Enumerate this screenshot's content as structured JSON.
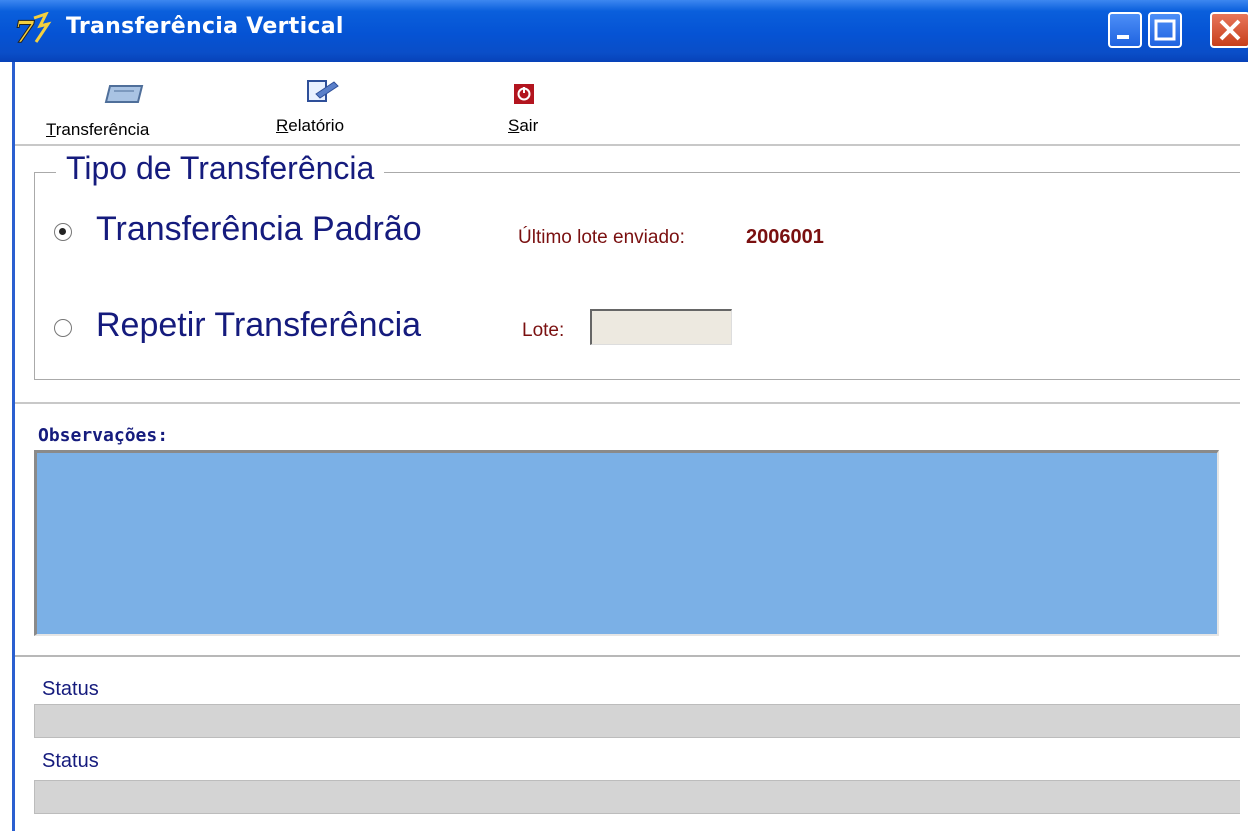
{
  "window": {
    "title": "Transferência Vertical",
    "logo_text": "7"
  },
  "toolbar": {
    "transfer": {
      "underline": "T",
      "rest": "ransferência"
    },
    "report": {
      "underline": "R",
      "rest": "elatório"
    },
    "exit": {
      "underline": "S",
      "rest": "air"
    }
  },
  "transfer_type": {
    "title": "Tipo de Transferência",
    "standard_label": "Transferência Padrão",
    "last_lot_label": "Último lote enviado:",
    "last_lot_value": "2006001",
    "repeat_label": "Repetir Transferência",
    "lot_label": "Lote:",
    "lot_value": "",
    "selected": "standard"
  },
  "observations": {
    "label": "Observações:",
    "value": ""
  },
  "status": [
    {
      "label": "Status"
    },
    {
      "label": "Status"
    }
  ],
  "colors": {
    "titlebar": "#0553d4",
    "label_navy": "#151b7d",
    "label_maroon": "#7a1010",
    "observations_bg": "#7bb0e6"
  },
  "icons": [
    "app-logo-icon",
    "minimize-icon",
    "maximize-icon",
    "close-icon",
    "transfer-icon",
    "report-icon",
    "exit-icon"
  ]
}
